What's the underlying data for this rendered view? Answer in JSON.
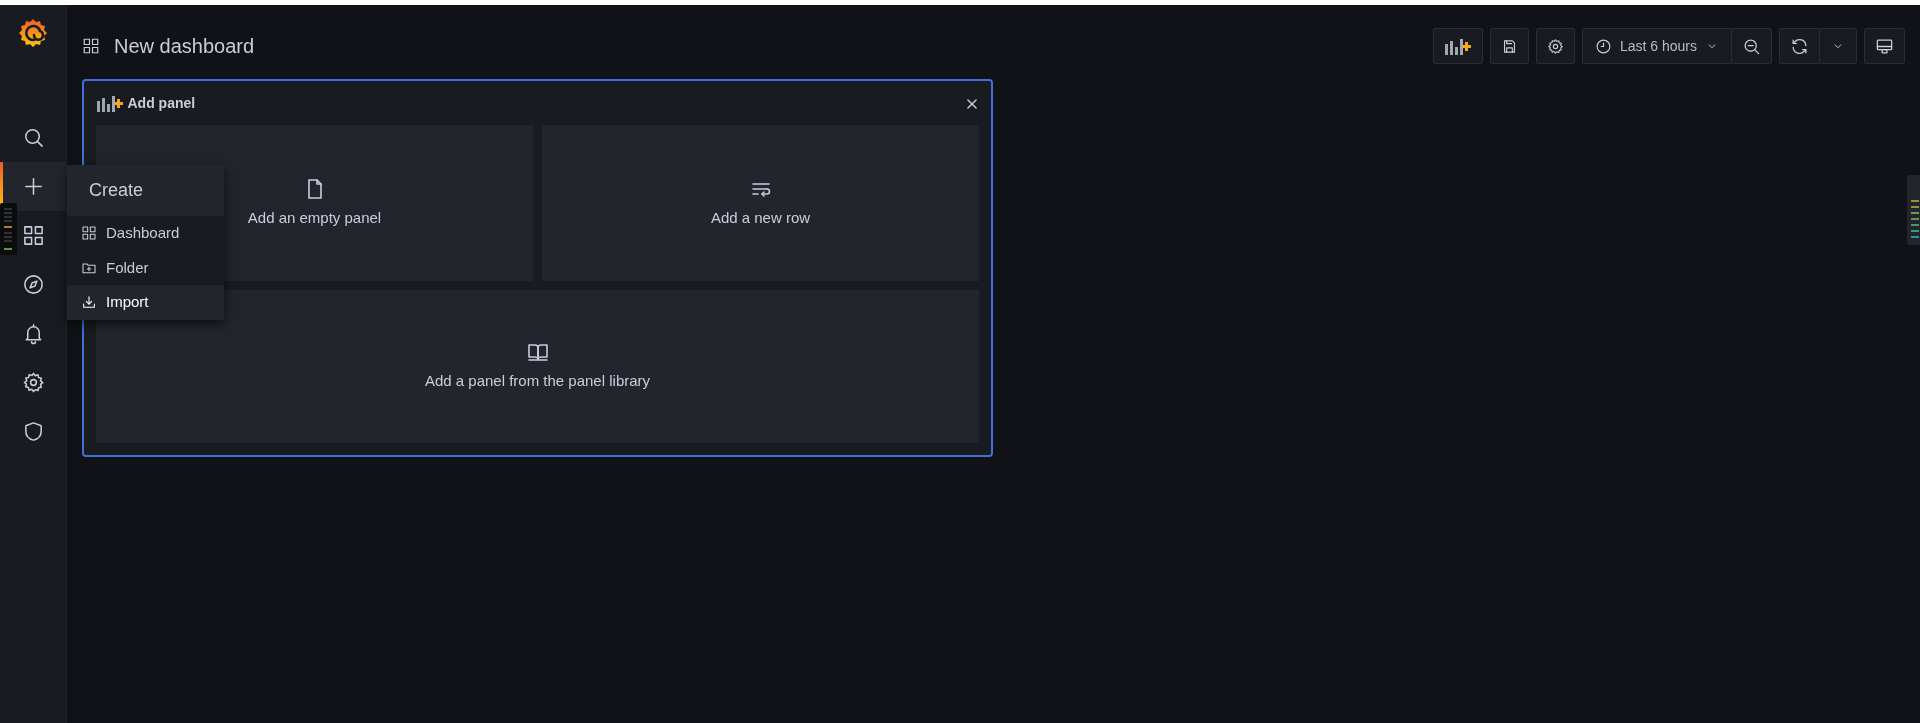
{
  "sidebar": {
    "items": [
      {
        "selected": false
      },
      {
        "selected": true
      },
      {
        "selected": false
      },
      {
        "selected": false
      },
      {
        "selected": false
      },
      {
        "selected": false
      },
      {
        "selected": false
      }
    ]
  },
  "create_menu": {
    "title": "Create",
    "items": [
      {
        "label": "Dashboard",
        "selected": false
      },
      {
        "label": "Folder",
        "selected": false
      },
      {
        "label": "Import",
        "selected": true
      }
    ]
  },
  "header": {
    "title": "New dashboard"
  },
  "toolbar": {
    "time_range": "Last 6 hours"
  },
  "add_panel": {
    "title": "Add panel",
    "options": [
      {
        "label": "Add an empty panel"
      },
      {
        "label": "Add a new row"
      },
      {
        "label": "Add a panel from the panel library"
      }
    ]
  }
}
